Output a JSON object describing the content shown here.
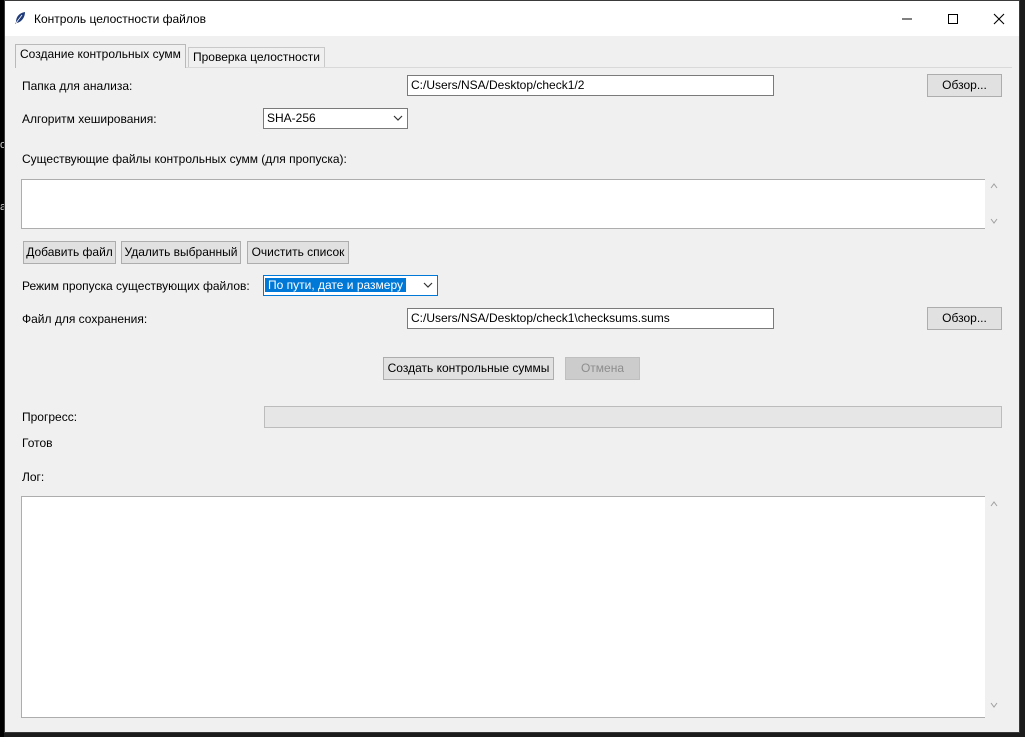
{
  "window": {
    "title": "Контроль целостности файлов",
    "controls": [
      "minimize-icon",
      "maximize-icon",
      "close-icon"
    ]
  },
  "background": {
    "left_glyphs": [
      "o",
      "a"
    ]
  },
  "tabs": [
    {
      "label": "Создание контрольных сумм",
      "active": true
    },
    {
      "label": "Проверка целостности",
      "active": false
    }
  ],
  "form": {
    "folder": {
      "label": "Папка для анализа:",
      "value": "C:/Users/NSA/Desktop/check1/2",
      "browse": "Обзор..."
    },
    "algorithm": {
      "label": "Алгоритм хеширования:",
      "value": "SHA-256"
    },
    "existing": {
      "label": "Существующие файлы контрольных сумм (для пропуска):"
    },
    "list_buttons": {
      "add": "Добавить файл",
      "remove": "Удалить выбранный",
      "clear": "Очистить список"
    },
    "skip_mode": {
      "label": "Режим пропуска существующих файлов:",
      "value": "По пути, дате и размеру"
    },
    "save_file": {
      "label": "Файл для сохранения:",
      "value": "C:/Users/NSA/Desktop/check1\\checksums.sums",
      "browse": "Обзор..."
    },
    "actions": {
      "create": "Создать контрольные суммы",
      "cancel": "Отмена",
      "cancel_enabled": false
    },
    "progress": {
      "label": "Прогресс:",
      "value": 0
    },
    "status": "Готов",
    "log": {
      "label": "Лог:",
      "content": ""
    }
  },
  "colors": {
    "accent": "#0078d7",
    "window_bg": "#f0f0f0"
  }
}
